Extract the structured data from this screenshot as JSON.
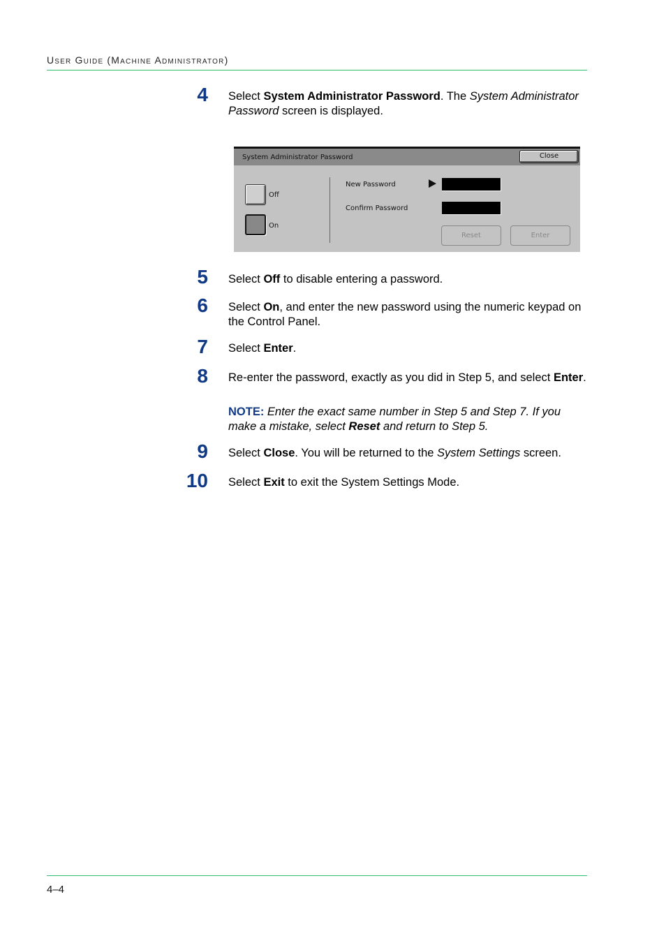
{
  "header": {
    "title": "User Guide (Machine Administrator)"
  },
  "footer": {
    "page_number": "4–4"
  },
  "steps": [
    {
      "number": "4",
      "parts": [
        [
          "t",
          "Select "
        ],
        [
          "b",
          "System Administrator Password"
        ],
        [
          "t",
          ". The "
        ],
        [
          "i",
          "System Administrator Password"
        ],
        [
          "t",
          " screen is displayed."
        ]
      ]
    },
    {
      "number": "5",
      "parts": [
        [
          "t",
          "Select "
        ],
        [
          "b",
          "Off"
        ],
        [
          "t",
          " to disable entering a password."
        ]
      ]
    },
    {
      "number": "6",
      "parts": [
        [
          "t",
          "Select "
        ],
        [
          "b",
          "On"
        ],
        [
          "t",
          ", and enter the new password using the numeric keypad on the Control Panel."
        ]
      ]
    },
    {
      "number": "7",
      "parts": [
        [
          "t",
          "Select "
        ],
        [
          "b",
          "Enter"
        ],
        [
          "t",
          "."
        ]
      ]
    },
    {
      "number": "8",
      "parts": [
        [
          "t",
          "Re-enter the password, exactly as you did in Step 5, and select "
        ],
        [
          "b",
          "Enter"
        ],
        [
          "t",
          "."
        ]
      ]
    },
    {
      "number": "9",
      "parts": [
        [
          "t",
          "Select "
        ],
        [
          "b",
          "Close"
        ],
        [
          "t",
          ". You will be returned to the "
        ],
        [
          "i",
          "System Settings"
        ],
        [
          "t",
          " screen."
        ]
      ]
    },
    {
      "number": "10",
      "parts": [
        [
          "t",
          "Select "
        ],
        [
          "b",
          "Exit"
        ],
        [
          "t",
          " to exit the System Settings Mode."
        ]
      ]
    }
  ],
  "note": {
    "label": "NOTE:",
    "parts": [
      [
        "i",
        " Enter the exact same number in Step 5 and Step 7. If you make a mistake, select "
      ],
      [
        "bi",
        "Reset"
      ],
      [
        "i",
        " and return to Step 5."
      ]
    ]
  },
  "screen": {
    "title": "System Administrator Password",
    "close_label": "Close",
    "off_label": "Off",
    "on_label": "On",
    "selected_toggle": "On",
    "new_password_label": "New Password",
    "confirm_password_label": "Confirm Password",
    "new_password_value": "",
    "confirm_password_value": "",
    "reset_label": "Reset",
    "enter_label": "Enter"
  }
}
